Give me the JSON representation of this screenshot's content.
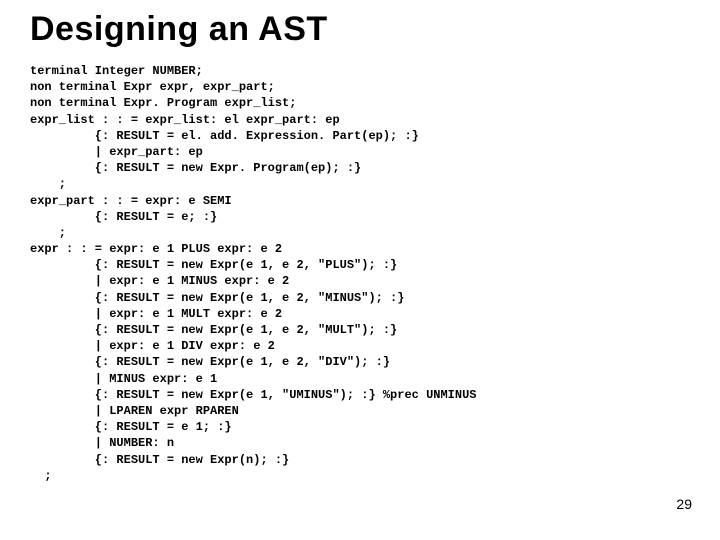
{
  "title": "Designing an AST",
  "code_lines": [
    "terminal Integer NUMBER;",
    "non terminal Expr expr, expr_part;",
    "non terminal Expr. Program expr_list;",
    "expr_list : : = expr_list: el expr_part: ep",
    "         {: RESULT = el. add. Expression. Part(ep); :}",
    "         | expr_part: ep",
    "         {: RESULT = new Expr. Program(ep); :}",
    "    ;",
    "expr_part : : = expr: e SEMI",
    "         {: RESULT = e; :}",
    "    ;",
    "expr : : = expr: e 1 PLUS expr: e 2",
    "         {: RESULT = new Expr(e 1, e 2, \"PLUS\"); :}",
    "         | expr: e 1 MINUS expr: e 2",
    "         {: RESULT = new Expr(e 1, e 2, \"MINUS\"); :}",
    "         | expr: e 1 MULT expr: e 2",
    "         {: RESULT = new Expr(e 1, e 2, \"MULT\"); :}",
    "         | expr: e 1 DIV expr: e 2",
    "         {: RESULT = new Expr(e 1, e 2, \"DIV\"); :}",
    "         | MINUS expr: e 1",
    "         {: RESULT = new Expr(e 1, \"UMINUS\"); :} %prec UNMINUS",
    "         | LPAREN expr RPAREN",
    "         {: RESULT = e 1; :}",
    "         | NUMBER: n",
    "         {: RESULT = new Expr(n); :}",
    "  ;"
  ],
  "page_number": "29"
}
